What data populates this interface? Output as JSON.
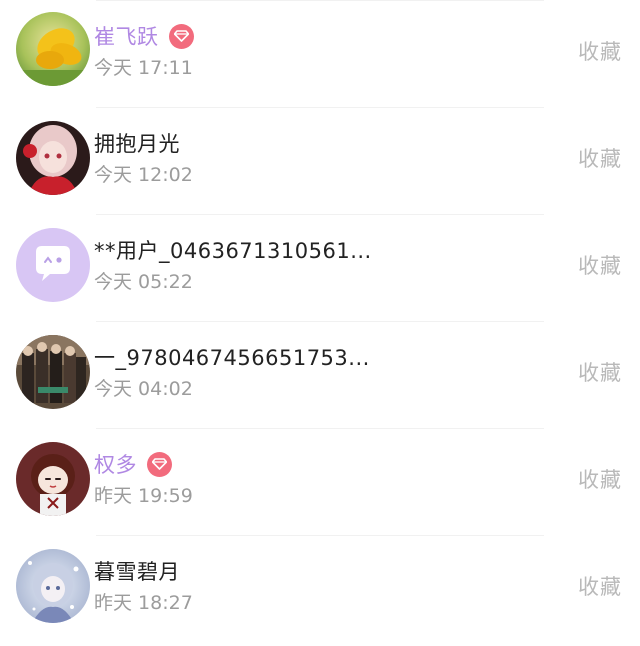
{
  "users": [
    {
      "name": "崔飞跃",
      "vip": true,
      "time": "今天 17:11",
      "action": "收藏",
      "avatar_icon": "yellow-flower-avatar"
    },
    {
      "name": "拥抱月光",
      "vip": false,
      "time": "今天 12:02",
      "action": "收藏",
      "avatar_icon": "anime-girl-red-avatar"
    },
    {
      "name": "**用户_0463671310561...",
      "vip": false,
      "time": "今天 05:22",
      "action": "收藏",
      "avatar_icon": "default-chat-bubble-avatar"
    },
    {
      "name": "一_9780467456651753...",
      "vip": false,
      "time": "今天 04:02",
      "action": "收藏",
      "avatar_icon": "group-photo-avatar"
    },
    {
      "name": "权多",
      "vip": true,
      "time": "昨天 19:59",
      "action": "收藏",
      "avatar_icon": "anime-chibi-avatar"
    },
    {
      "name": "暮雪碧月",
      "vip": false,
      "time": "昨天 18:27",
      "action": "收藏",
      "avatar_icon": "snow-girl-avatar"
    }
  ],
  "colors": {
    "vip_name": "#b088e3",
    "vip_badge": "#f26b7d",
    "default_avatar": "#d8c6f4"
  }
}
